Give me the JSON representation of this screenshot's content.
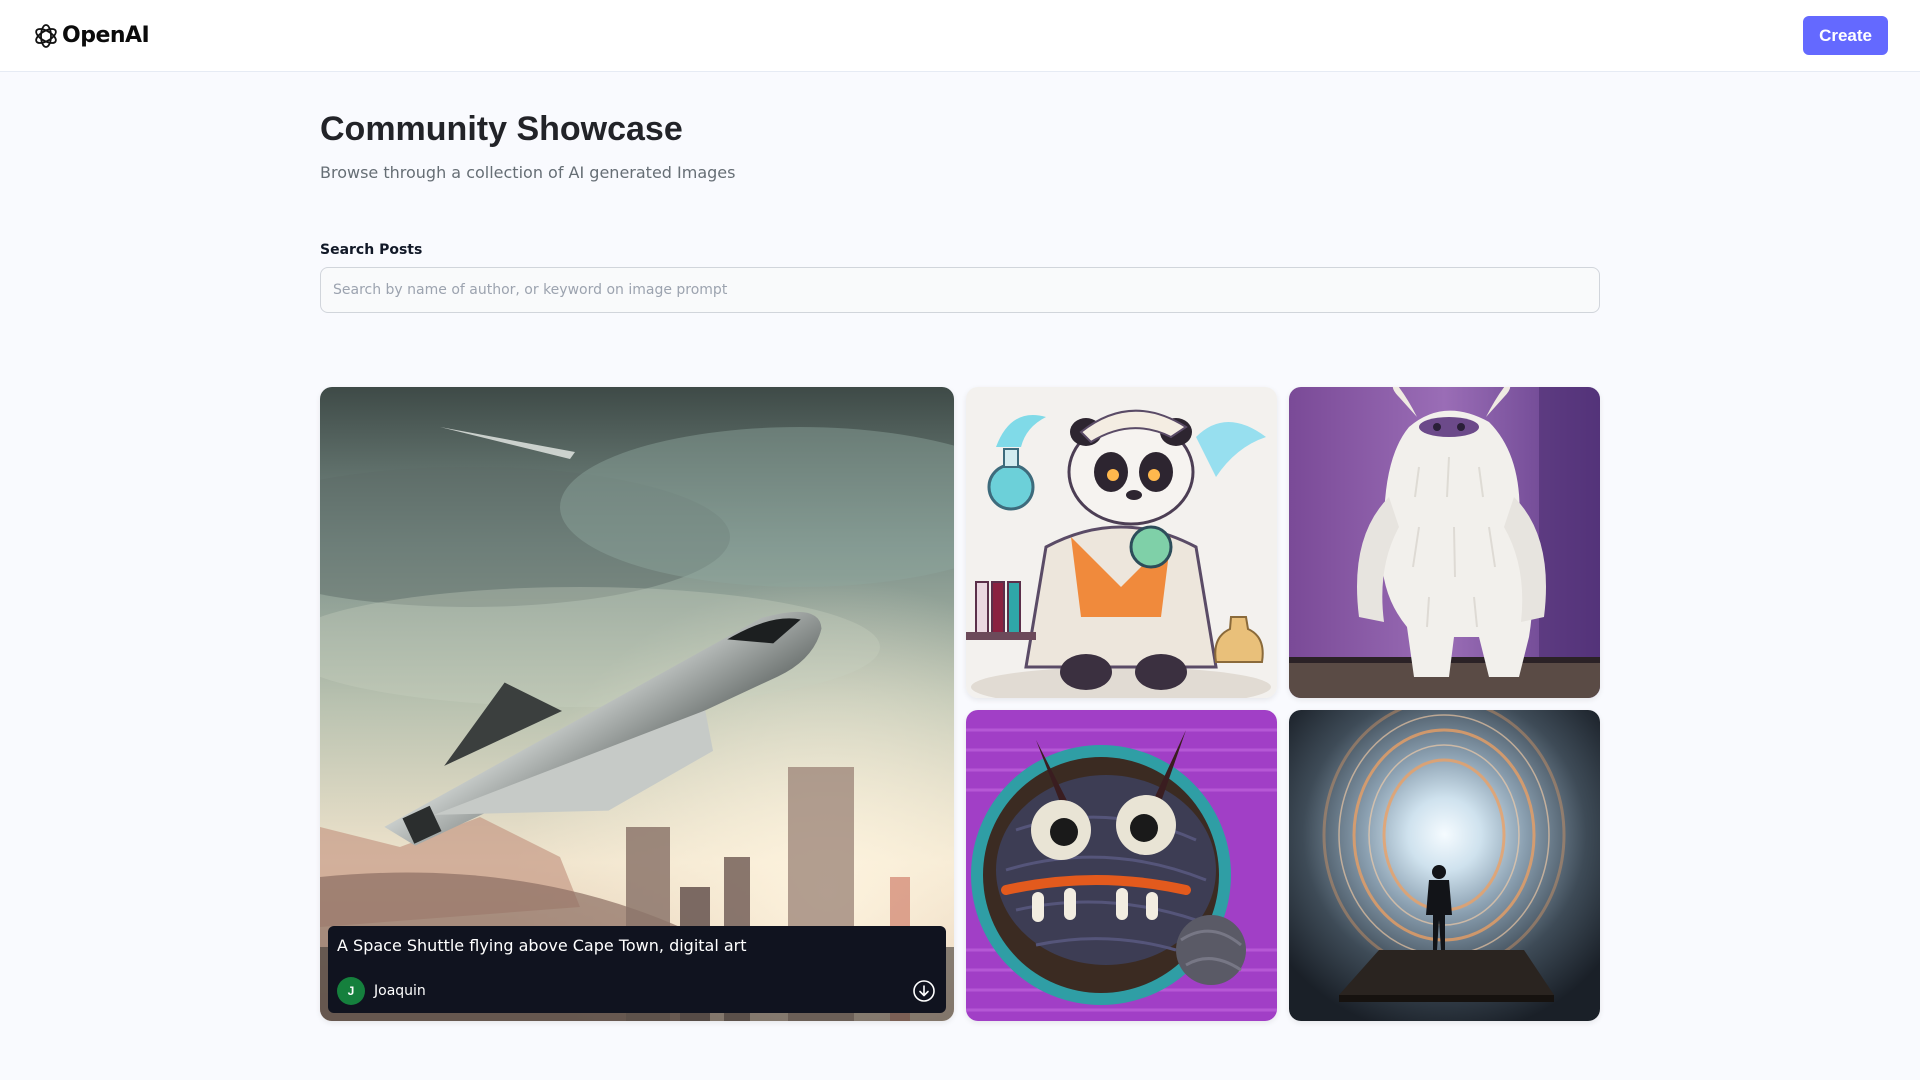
{
  "header": {
    "logo_text": "OpenAI",
    "create_label": "Create",
    "accent_color": "#6469ff"
  },
  "main": {
    "title": "Community Showcase",
    "subtitle": "Browse through a collection of AI generated Images",
    "search": {
      "label": "Search Posts",
      "placeholder": "Search by name of author, or keyword on image prompt",
      "value": ""
    }
  },
  "gallery": {
    "featured": {
      "prompt": "A Space Shuttle flying above Cape Town, digital art",
      "author": "Joaquin",
      "author_initial": "J",
      "avatar_color": "#15803d",
      "download_icon": "download-icon"
    },
    "cards": [
      {
        "image": "space-shuttle-over-city"
      },
      {
        "image": "panda-scientist"
      },
      {
        "image": "white-furry-monster"
      },
      {
        "image": "yarn-monster-bowl"
      },
      {
        "image": "man-in-light-tunnel"
      }
    ]
  }
}
